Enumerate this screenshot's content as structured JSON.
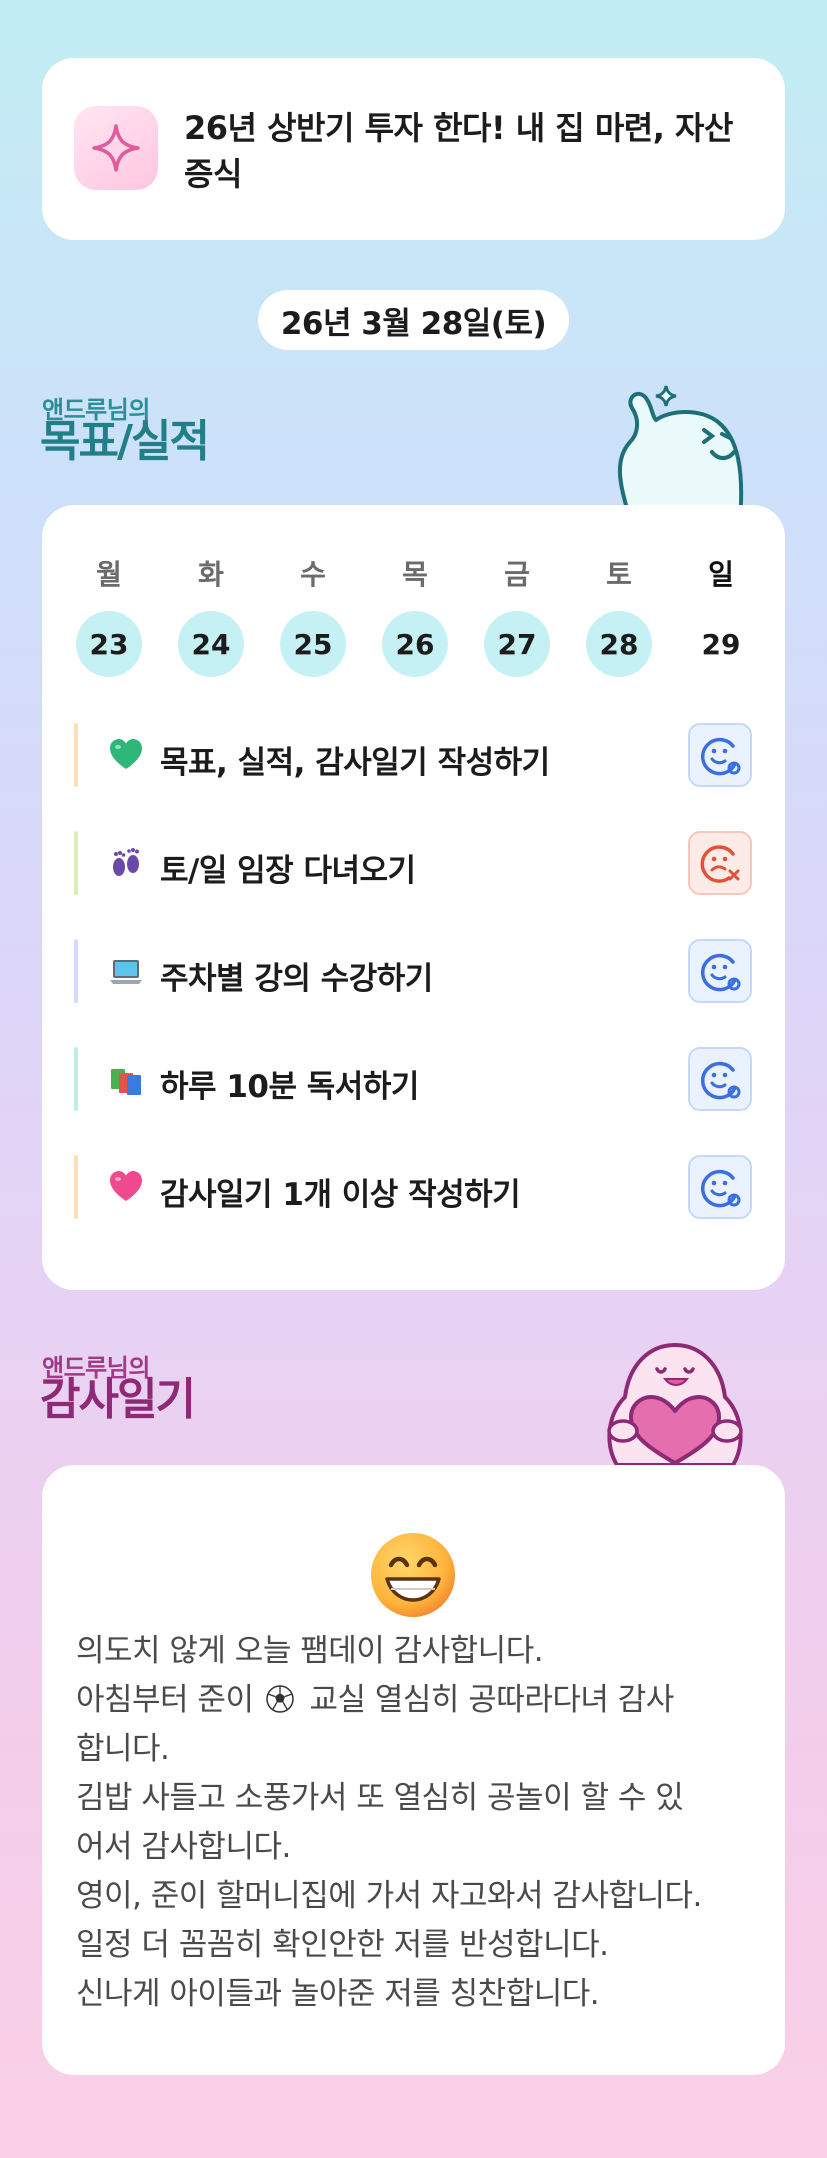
{
  "goal_banner": {
    "text": "26년 상반기 투자 한다! 내 집 마련, 자산 증식"
  },
  "date": "26년 3월 28일(토)",
  "goals_section": {
    "sub": "앤드루님의",
    "title": "목표/실적"
  },
  "week": [
    {
      "name": "월",
      "num": "23"
    },
    {
      "name": "화",
      "num": "24"
    },
    {
      "name": "수",
      "num": "25"
    },
    {
      "name": "목",
      "num": "26"
    },
    {
      "name": "금",
      "num": "27"
    },
    {
      "name": "토",
      "num": "28"
    },
    {
      "name": "일",
      "num": "29"
    }
  ],
  "tasks": [
    {
      "label": "목표, 실적, 감사일기 작성하기",
      "emoji": "green-heart-icon",
      "bar_color": "#fde0b3",
      "status": "done"
    },
    {
      "label": "토/일 임장 다녀오기",
      "emoji": "footprints-icon",
      "bar_color": "#d9efb5",
      "status": "failed"
    },
    {
      "label": "주차별 강의 수강하기",
      "emoji": "laptop-icon",
      "bar_color": "#cfdcfb",
      "status": "done"
    },
    {
      "label": "하루 10분 독서하기",
      "emoji": "books-icon",
      "bar_color": "#bff0db",
      "status": "done"
    },
    {
      "label": "감사일기 1개 이상 작성하기",
      "emoji": "pink-heart-icon",
      "bar_color": "#fde0b3",
      "status": "done"
    }
  ],
  "colors": {
    "done_icon": "#3b6fe0",
    "failed_icon": "#e0533a",
    "day_circle": "#c6f1f4",
    "goals_heading": "#237f87",
    "thanks_heading": "#8e2a75"
  },
  "thanks_section": {
    "sub": "앤드루님의",
    "title": "감사일기"
  },
  "diary": {
    "lines": [
      "의도치 않게 오늘 팸데이 감사합니다.",
      "아침부터 준이",
      "교실 열심히 공따라다녀 감사",
      "합니다.",
      "김밥 사들고 소풍가서 또 열심히 공놀이 할 수 있",
      "어서 감사합니다.",
      "영이, 준이 할머니집에 가서 자고와서 감사합니다.",
      "일정 더 꼼꼼히 확인안한 저를 반성합니다.",
      "신나게 아이들과 놀아준 저를 칭찬합니다."
    ]
  }
}
